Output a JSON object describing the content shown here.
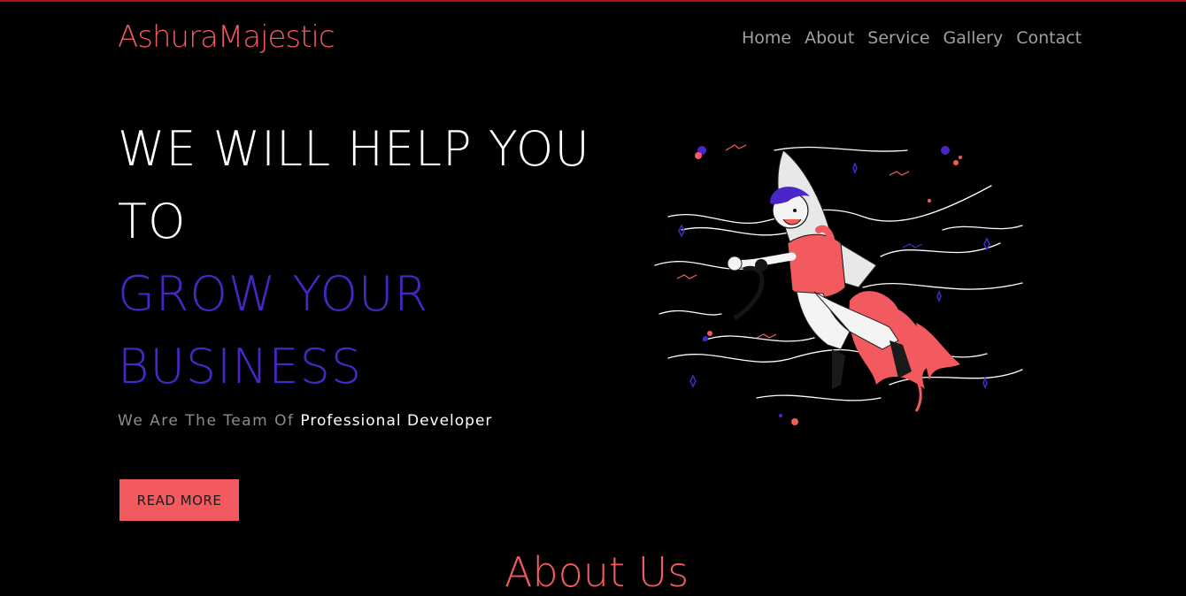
{
  "header": {
    "logo": "AshuraMajestic",
    "nav": [
      "Home",
      "About",
      "Service",
      "Gallery",
      "Contact"
    ]
  },
  "hero": {
    "line1": "WE WILL HELP YOU",
    "line2": "TO",
    "line3": "GROW YOUR",
    "line4": "BUSINESS",
    "sub_prefix": "We Are The Team Of",
    "sub_highlight": "Professional Developer",
    "button_label": "READ MORE",
    "illustration_icon": "rocket-boy-illustration-icon"
  },
  "about": {
    "title": "About Us"
  },
  "colors": {
    "accent": "#f25a5f",
    "purple": "#4a26c9",
    "background": "#000000",
    "nav_text": "#a0a0a0",
    "top_border": "#b0151b"
  }
}
